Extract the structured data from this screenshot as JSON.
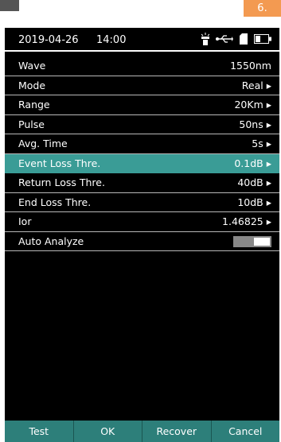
{
  "corner": {
    "left_text": "",
    "right_text": "6."
  },
  "status": {
    "date": "2019-04-26",
    "time": "14:00",
    "icons": [
      "flashlight-icon",
      "usb-icon",
      "sd-card-icon",
      "battery-icon"
    ]
  },
  "settings": [
    {
      "label": "Wave",
      "value": "1550nm"
    },
    {
      "label": "Mode",
      "value": "Real ▸"
    },
    {
      "label": "Range",
      "value": "20Km ▸"
    },
    {
      "label": "Pulse",
      "value": "50ns ▸"
    },
    {
      "label": "Avg. Time",
      "value": "5s ▸"
    },
    {
      "label": "Event Loss Thre.",
      "value": "0.1dB ▸",
      "selected": true
    },
    {
      "label": "Return Loss Thre.",
      "value": "40dB ▸"
    },
    {
      "label": "End Loss Thre.",
      "value": "10dB ▸"
    },
    {
      "label": "Ior",
      "value": "1.46825 ▸"
    },
    {
      "label": "Auto Analyze",
      "value": "",
      "toggle": true
    }
  ],
  "buttons": {
    "test": "Test",
    "ok": "OK",
    "recover": "Recover",
    "cancel": "Cancel"
  },
  "colors": {
    "accent": "#3a9c96",
    "button": "#2d7f7a",
    "orange": "#f39a51"
  }
}
